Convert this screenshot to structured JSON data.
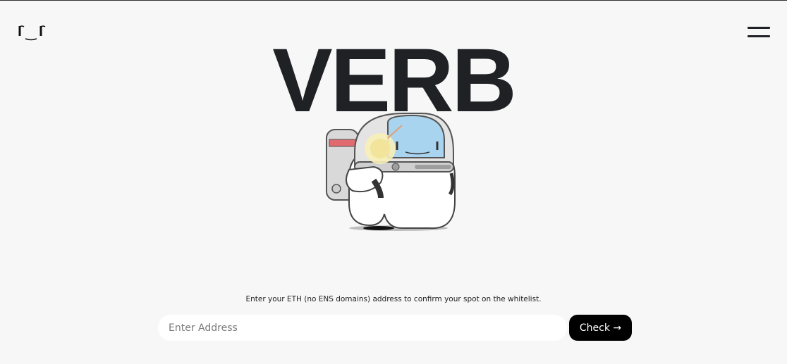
{
  "header": {
    "logo_icon": "face-logo-icon",
    "menu_icon": "hamburger-menu-icon"
  },
  "hero": {
    "brand": "VERB",
    "mascot_icon": "astronaut-mascot-illustration"
  },
  "whitelist": {
    "prompt": "Enter your ETH (no ENS domains) address to confirm your spot on the whitelist.",
    "input_placeholder": "Enter Address",
    "input_value": "",
    "button_label": "Check →"
  },
  "colors": {
    "background": "#f6f7f6",
    "text": "#1f2125",
    "button": "#000000",
    "input": "#ffffff"
  }
}
